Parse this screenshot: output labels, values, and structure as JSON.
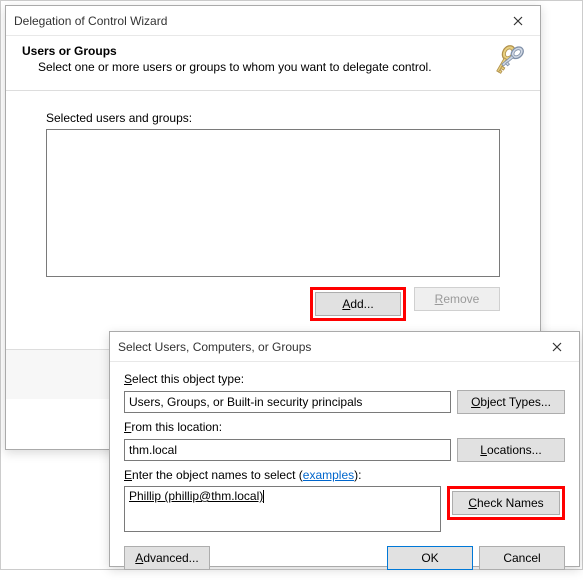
{
  "dlg1": {
    "title": "Delegation of Control Wizard",
    "heading": "Users or Groups",
    "subheading": "Select one or more users or groups to whom you want to delegate control.",
    "selected_label": "Selected users and groups:",
    "add_label": "Add...",
    "remove_label": "Remove"
  },
  "dlg2": {
    "title": "Select Users, Computers, or Groups",
    "object_type_label": "Select this object type:",
    "object_type_value": "Users, Groups, or Built-in security principals",
    "object_types_btn": "Object Types...",
    "location_label": "From this location:",
    "location_value": "thm.local",
    "locations_btn": "Locations...",
    "enter_label_pre": "Enter the object names to select (",
    "enter_label_link": "examples",
    "enter_label_post": "):",
    "enter_value": "Phillip (phillip@thm.local)",
    "check_names_btn": "Check Names",
    "advanced_btn": "Advanced...",
    "ok_btn": "OK",
    "cancel_btn": "Cancel"
  }
}
